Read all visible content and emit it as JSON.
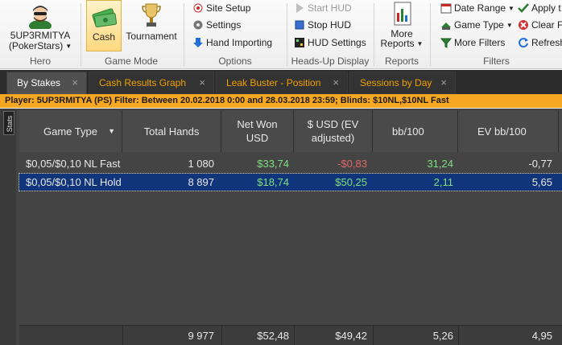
{
  "ribbon": {
    "hero": {
      "name_line1": "5UP3RMITYA",
      "name_line2": "(PokerStars)",
      "group_label": "Hero"
    },
    "game_mode": {
      "cash_label": "Cash",
      "tournament_label": "Tournament",
      "group_label": "Game Mode"
    },
    "options": {
      "site_setup": "Site Setup",
      "settings": "Settings",
      "hand_importing": "Hand Importing",
      "group_label": "Options"
    },
    "hud": {
      "start_hud": "Start HUD",
      "stop_hud": "Stop HUD",
      "hud_settings": "HUD Settings",
      "group_label": "Heads-Up Display"
    },
    "reports": {
      "more_reports_line1": "More",
      "more_reports_line2": "Reports",
      "group_label": "Reports"
    },
    "filters": {
      "date_range": "Date Range",
      "game_type": "Game Type",
      "more_filters": "More Filters",
      "apply": "Apply t",
      "clear": "Clear F",
      "refresh": "Refresh",
      "group_label": "Filters"
    }
  },
  "tabs": [
    {
      "label": "By Stakes",
      "active": true
    },
    {
      "label": "Cash Results Graph",
      "active": false
    },
    {
      "label": "Leak Buster - Position",
      "active": false
    },
    {
      "label": "Sessions by Day",
      "active": false
    }
  ],
  "tab_close": "×",
  "filter_text": "Player: 5UP3RMITYA (PS)  Filter: Between 20.02.2018 0:00 and 28.03.2018 23:59; Blinds: $10NL,$10NL Fast",
  "side_tab": "Stats",
  "table": {
    "columns": [
      "Game Type",
      "Total Hands",
      "Net Won USD",
      "$ USD (EV adjusted)",
      "bb/100",
      "EV bb/100"
    ],
    "sort_arrow": "▼",
    "rows": [
      {
        "game_type": "$0,05/$0,10 NL Fast",
        "total_hands": "1 080",
        "net_won": "$33,74",
        "usd_ev": "-$0,83",
        "bb100": "31,24",
        "ev_bb100": "-0,77"
      },
      {
        "game_type": "$0,05/$0,10 NL Hold",
        "total_hands": "8 897",
        "net_won": "$18,74",
        "usd_ev": "$50,25",
        "bb100": "2,11",
        "ev_bb100": "5,65"
      }
    ],
    "totals": {
      "total_hands": "9 977",
      "net_won": "$52,48",
      "usd_ev": "$49,42",
      "bb100": "5,26",
      "ev_bb100": "4,95"
    }
  },
  "colors": {
    "positive": "#7fe07f",
    "negative": "#e06868",
    "filter_bar": "#f5a623",
    "selected_row": "#10357a",
    "tab_text": "#f0a000"
  }
}
